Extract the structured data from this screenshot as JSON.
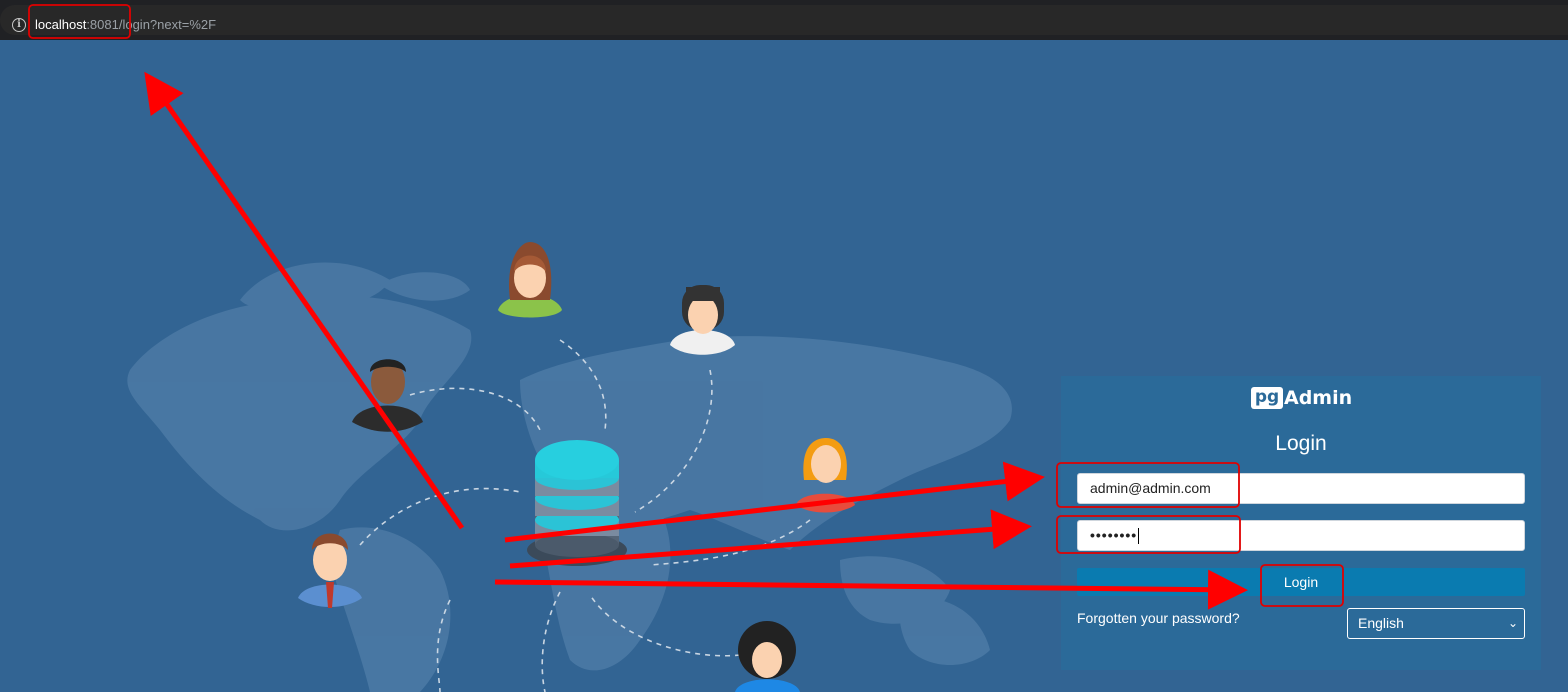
{
  "browser": {
    "url_host": "localhost",
    "url_rest": ":8081/login?next=%2F",
    "info_icon": "info-circle-icon"
  },
  "login": {
    "logo_pg": "pg",
    "logo_admin": "Admin",
    "title": "Login",
    "email_value": "admin@admin.com",
    "password_value": "••••••••",
    "button_label": "Login",
    "forgot_label": "Forgotten your password?",
    "language_selected": "English"
  },
  "colors": {
    "background": "#326493",
    "panel": "#2b6a99",
    "button": "#0a7bb0",
    "annotation": "#ff0000"
  }
}
